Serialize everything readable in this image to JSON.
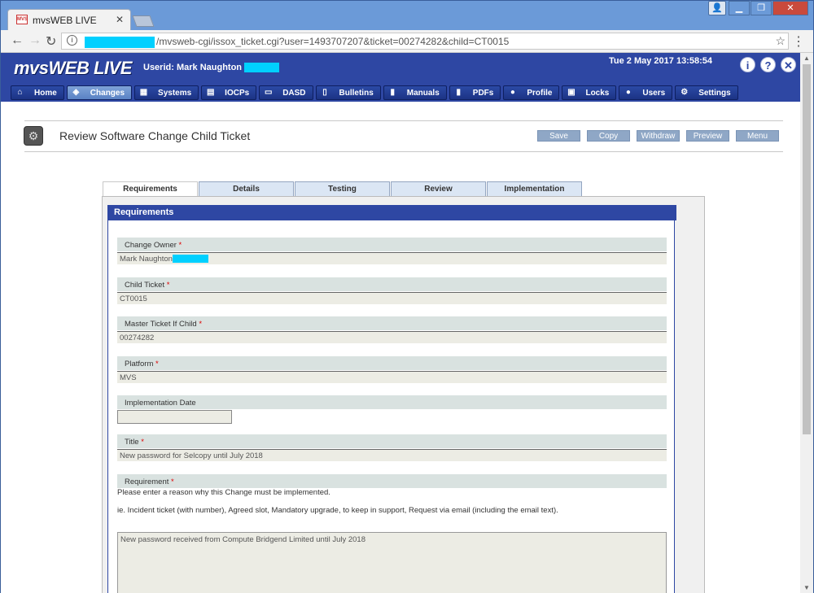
{
  "browser": {
    "tab_title": "mvsWEB LIVE",
    "favicon_text": "MVS",
    "url": "/mvsweb-cgi/issox_ticket.cgi?user=1493707207&ticket=00274282&child=CT0015"
  },
  "app": {
    "logo": "mvsWEB LIVE",
    "userid": "Userid: Mark Naughton",
    "datetime": "Tue 2 May 2017 13:58:54",
    "header_icons": [
      "info-icon",
      "help-icon",
      "close-icon"
    ]
  },
  "menu": [
    {
      "label": "Home",
      "icon": "home-icon"
    },
    {
      "label": "Changes",
      "icon": "changes-icon"
    },
    {
      "label": "Systems",
      "icon": "systems-icon"
    },
    {
      "label": "IOCPs",
      "icon": "iocps-icon"
    },
    {
      "label": "DASD",
      "icon": "dasd-icon"
    },
    {
      "label": "Bulletins",
      "icon": "bulletins-icon"
    },
    {
      "label": "Manuals",
      "icon": "manuals-icon"
    },
    {
      "label": "PDFs",
      "icon": "pdfs-icon"
    },
    {
      "label": "Profile",
      "icon": "profile-icon"
    },
    {
      "label": "Locks",
      "icon": "locks-icon"
    },
    {
      "label": "Users",
      "icon": "users-icon"
    },
    {
      "label": "Settings",
      "icon": "settings-icon"
    }
  ],
  "page": {
    "title": "Review Software Change Child Ticket",
    "actions": [
      "Save",
      "Copy",
      "Withdraw",
      "Preview",
      "Menu"
    ]
  },
  "tabs": [
    "Requirements",
    "Details",
    "Testing",
    "Review",
    "Implementation"
  ],
  "section": {
    "header": "Requirements",
    "fields": {
      "change_owner": {
        "label": "Change Owner",
        "value": "Mark Naughton"
      },
      "child_ticket": {
        "label": "Child Ticket",
        "value": "CT0015"
      },
      "master_ticket": {
        "label": "Master Ticket If Child",
        "value": "00274282"
      },
      "platform": {
        "label": "Platform",
        "value": "MVS"
      },
      "impl_date": {
        "label": "Implementation Date",
        "value": ""
      },
      "title": {
        "label": "Title",
        "value": "New password for Selcopy until July 2018"
      },
      "requirement": {
        "label": "Requirement",
        "help1": "Please enter a reason why this Change must be implemented.",
        "help2": "ie. Incident ticket (with number), Agreed slot, Mandatory upgrade, to keep in support, Request via email (including the email text).",
        "value": "New password received from Compute Bridgend Limited until July 2018"
      }
    },
    "required_marker": "*"
  }
}
